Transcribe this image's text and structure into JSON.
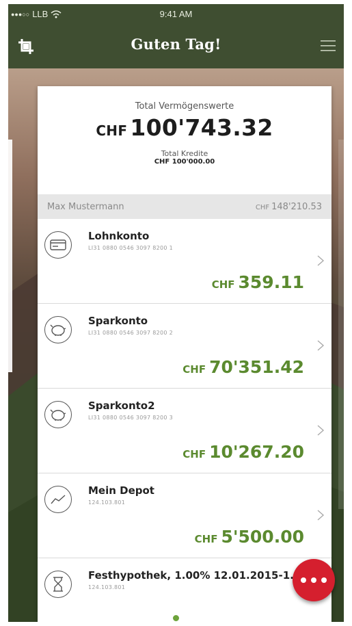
{
  "status": {
    "signal": "●●●○○",
    "carrier": "LLB",
    "time": "9:41 AM"
  },
  "nav": {
    "title": "Guten Tag!",
    "left_icon": "crop-icon",
    "right_icon": "menu-icon"
  },
  "summary": {
    "total_label": "Total Vermögenswerte",
    "total_currency": "CHF",
    "total_value": "100'743.32",
    "credit_label": "Total Kredite",
    "credit_value": "CHF 100'000.00"
  },
  "owner": {
    "name": "Max Mustermann",
    "currency": "CHF",
    "amount": "148'210.53"
  },
  "accounts": [
    {
      "name": "Lohnkonto",
      "iban": "LI31 0880 0546 3097 8200 1",
      "currency": "CHF",
      "amount": "359.11",
      "icon": "card-icon"
    },
    {
      "name": "Sparkonto",
      "iban": "LI31 0880 0546 3097 8200 2",
      "currency": "CHF",
      "amount": "70'351.42",
      "icon": "piggy-bank-icon"
    },
    {
      "name": "Sparkonto2",
      "iban": "LI31 0880 0546 3097 8200 3",
      "currency": "CHF",
      "amount": "10'267.20",
      "icon": "piggy-bank-icon"
    },
    {
      "name": "Mein Depot",
      "iban": "124.103.801",
      "currency": "CHF",
      "amount": "5'500.00",
      "icon": "chart-line-icon"
    },
    {
      "name": "Festhypothek, 1.00% 12.01.2015-1...",
      "iban": "124.103.801",
      "currency": "",
      "amount": "",
      "icon": "hourglass-icon"
    }
  ],
  "colors": {
    "header": "#3f4e31",
    "accent_green": "#5b8a2f",
    "fab_red": "#d51f2e"
  },
  "pager": {
    "active_index": 1,
    "count": 3
  }
}
